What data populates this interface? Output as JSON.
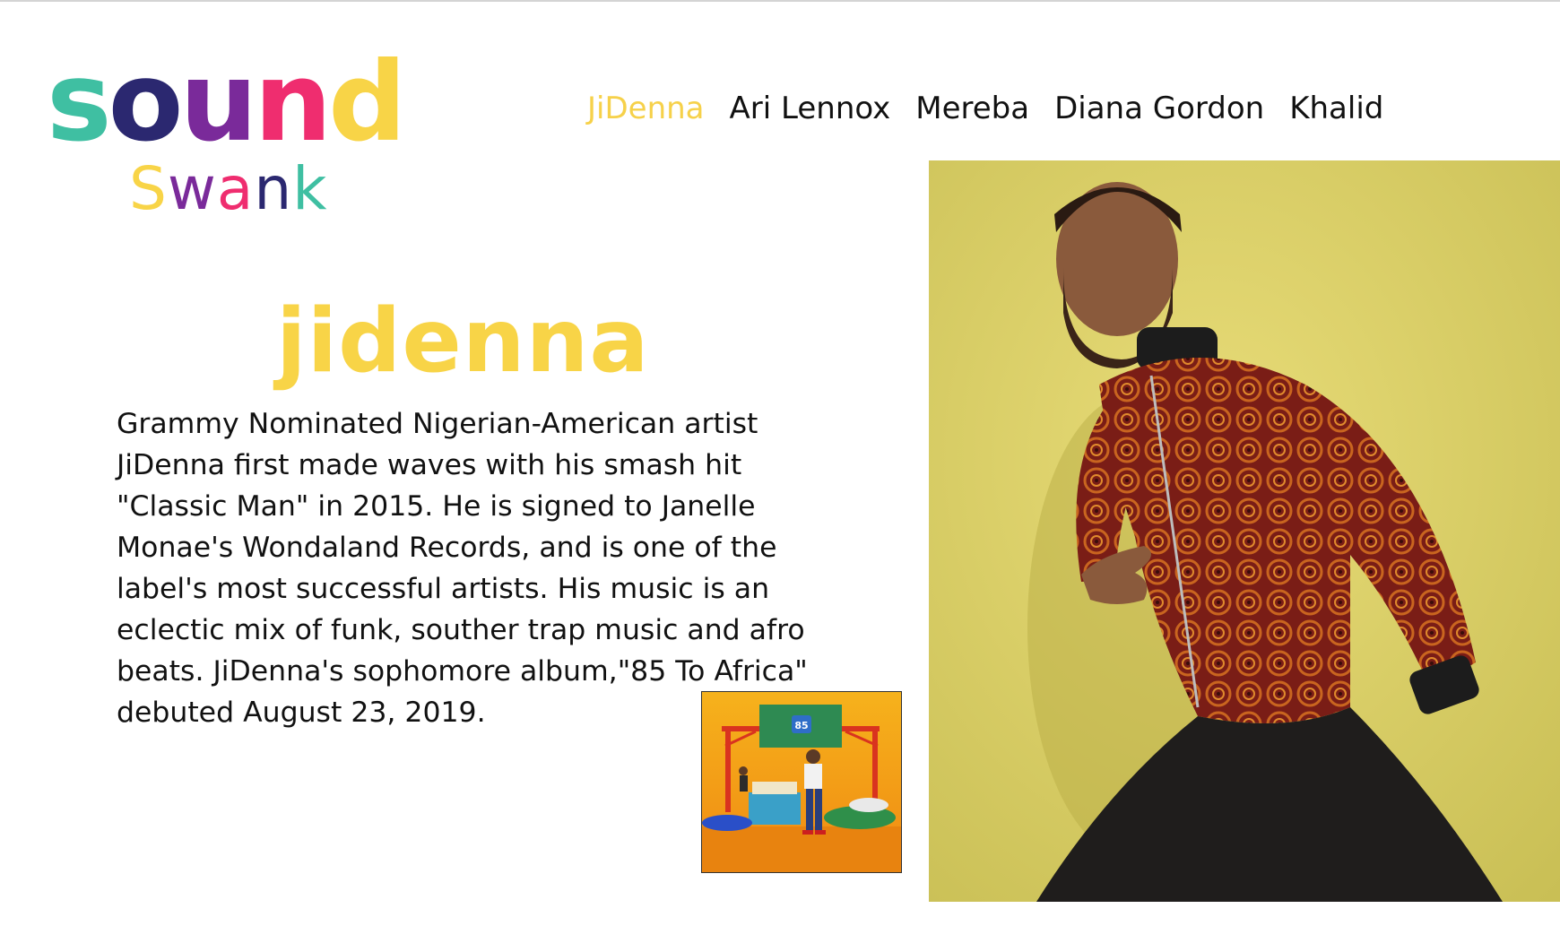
{
  "logo": {
    "word_top": [
      "s",
      "o",
      "u",
      "n",
      "d"
    ],
    "word_top_colors": [
      "#3fbfa2",
      "#2b2870",
      "#7a2a9a",
      "#ef2d6f",
      "#f8d447"
    ],
    "word_bottom": [
      "S",
      "w",
      "a",
      "n",
      "k"
    ],
    "word_bottom_colors": [
      "#f8d447",
      "#7a2a9a",
      "#ef2d6f",
      "#2b2870",
      "#3fbfa2"
    ]
  },
  "nav": {
    "items": [
      {
        "label": "JiDenna",
        "active": true
      },
      {
        "label": "Ari Lennox",
        "active": false
      },
      {
        "label": "Mereba",
        "active": false
      },
      {
        "label": "Diana Gordon",
        "active": false
      },
      {
        "label": "Khalid",
        "active": false
      }
    ]
  },
  "artist": {
    "title": "jidenna",
    "bio_lines": [
      "Grammy Nominated Nigerian-American artist",
      "JiDenna first made waves with his smash hit",
      "\"Classic Man\" in 2015. He is signed to Janelle",
      "Monae's Wondaland Records, and is one of the",
      " label's most successful artists. His music is an",
      "eclectic mix of funk, souther trap music and afro",
      "beats. JiDenna's sophomore album,\"85 To Africa\"",
      "debuted August 23, 2019."
    ]
  },
  "album_art": {
    "sign_text": "85",
    "icon": "album-cover-image"
  },
  "portrait": {
    "icon": "artist-portrait-photo"
  },
  "colors": {
    "accent_yellow": "#f8d447",
    "nav_active": "#f6d14a",
    "text": "#111111",
    "portrait_bg": "#e0d562"
  }
}
